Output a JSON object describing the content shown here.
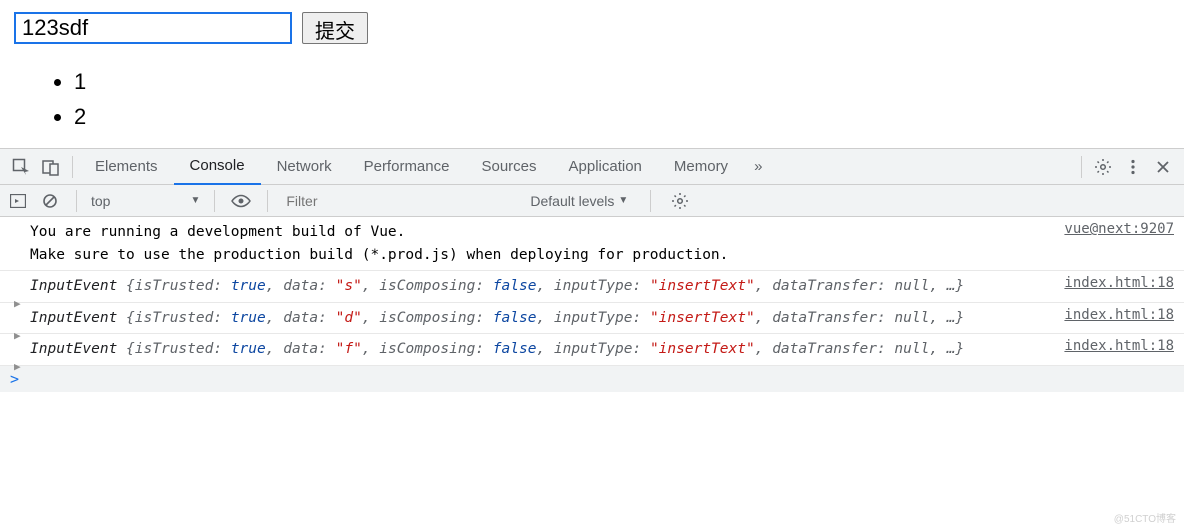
{
  "form": {
    "input_value": "123sdf",
    "submit_label": "提交"
  },
  "list": {
    "items": [
      "1",
      "2"
    ]
  },
  "devtools": {
    "tabs": [
      "Elements",
      "Console",
      "Network",
      "Performance",
      "Sources",
      "Application",
      "Memory"
    ],
    "active_tab_index": 1,
    "more_tabs_glyph": "»",
    "toolbar": {
      "context": "top",
      "filter_placeholder": "Filter",
      "levels_label": "Default levels"
    },
    "messages": [
      {
        "type": "text",
        "text": "You are running a development build of Vue.\nMake sure to use the production build (*.prod.js) when deploying for production.",
        "source": "vue@next:9207"
      },
      {
        "type": "object",
        "class": "InputEvent",
        "props": {
          "isTrusted": {
            "kind": "bool",
            "value": "true"
          },
          "data": {
            "kind": "str",
            "value": "\"s\""
          },
          "isComposing": {
            "kind": "bool",
            "value": "false"
          },
          "inputType": {
            "kind": "str",
            "value": "\"insertText\""
          },
          "dataTransfer": {
            "kind": "null",
            "value": "null"
          }
        },
        "tail": ", …}",
        "source": "index.html:18"
      },
      {
        "type": "object",
        "class": "InputEvent",
        "props": {
          "isTrusted": {
            "kind": "bool",
            "value": "true"
          },
          "data": {
            "kind": "str",
            "value": "\"d\""
          },
          "isComposing": {
            "kind": "bool",
            "value": "false"
          },
          "inputType": {
            "kind": "str",
            "value": "\"insertText\""
          },
          "dataTransfer": {
            "kind": "null",
            "value": "null"
          }
        },
        "tail": ", …}",
        "source": "index.html:18"
      },
      {
        "type": "object",
        "class": "InputEvent",
        "props": {
          "isTrusted": {
            "kind": "bool",
            "value": "true"
          },
          "data": {
            "kind": "str",
            "value": "\"f\""
          },
          "isComposing": {
            "kind": "bool",
            "value": "false"
          },
          "inputType": {
            "kind": "str",
            "value": "\"insertText\""
          },
          "dataTransfer": {
            "kind": "null",
            "value": "null"
          }
        },
        "tail": ", …}",
        "source": "index.html:18"
      }
    ],
    "prompt_glyph": ">"
  },
  "watermark": "@51CTO博客"
}
